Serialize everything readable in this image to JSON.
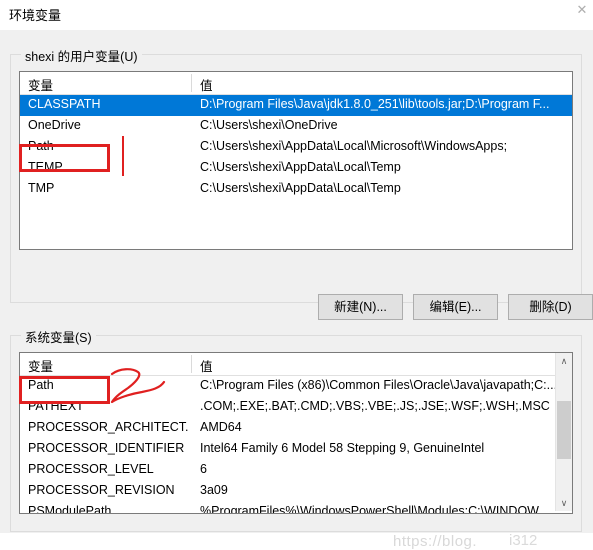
{
  "window": {
    "title": "环境变量",
    "close_glyph": "✕"
  },
  "user_section": {
    "legend": "shexi 的用户变量(U)",
    "columns": {
      "name": "变量",
      "value": "值"
    },
    "rows": [
      {
        "name": "CLASSPATH",
        "value": "D:\\Program Files\\Java\\jdk1.8.0_251\\lib\\tools.jar;D:\\Program F..."
      },
      {
        "name": "OneDrive",
        "value": "C:\\Users\\shexi\\OneDrive"
      },
      {
        "name": "Path",
        "value": "C:\\Users\\shexi\\AppData\\Local\\Microsoft\\WindowsApps;"
      },
      {
        "name": "TEMP",
        "value": "C:\\Users\\shexi\\AppData\\Local\\Temp"
      },
      {
        "name": "TMP",
        "value": "C:\\Users\\shexi\\AppData\\Local\\Temp"
      }
    ],
    "buttons": {
      "new": "新建(N)...",
      "edit": "编辑(E)...",
      "delete": "删除(D)"
    }
  },
  "system_section": {
    "legend": "系统变量(S)",
    "columns": {
      "name": "变量",
      "value": "值"
    },
    "rows": [
      {
        "name": "Path",
        "value": "C:\\Program Files (x86)\\Common Files\\Oracle\\Java\\javapath;C:..."
      },
      {
        "name": "PATHEXT",
        "value": ".COM;.EXE;.BAT;.CMD;.VBS;.VBE;.JS;.JSE;.WSF;.WSH;.MSC"
      },
      {
        "name": "PROCESSOR_ARCHITECT...",
        "value": "AMD64"
      },
      {
        "name": "PROCESSOR_IDENTIFIER",
        "value": "Intel64 Family 6 Model 58 Stepping 9, GenuineIntel"
      },
      {
        "name": "PROCESSOR_LEVEL",
        "value": "6"
      },
      {
        "name": "PROCESSOR_REVISION",
        "value": "3a09"
      },
      {
        "name": "PSModulePath",
        "value": "%ProgramFiles%\\WindowsPowerShell\\Modules;C:\\WINDOW..."
      }
    ],
    "scrollbar": {
      "up_glyph": "∧",
      "down_glyph": "∨"
    }
  },
  "watermark": {
    "text": "https://blog.",
    "text2": "i312"
  },
  "colors": {
    "selection": "#0078d7",
    "annotation": "#e02020",
    "dialog_bg": "#f0f0f0"
  }
}
